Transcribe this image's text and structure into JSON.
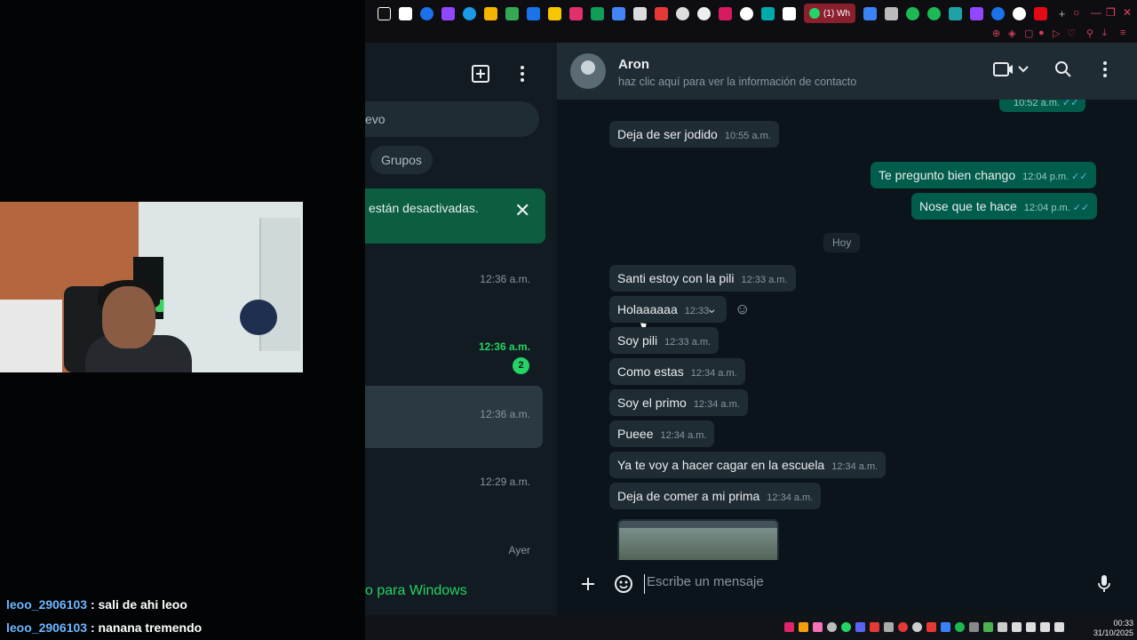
{
  "stream": {
    "chat": [
      {
        "user": "leoo_2906103",
        "message": ": sali de ahi leoo"
      },
      {
        "user": "leoo_2906103",
        "message": ": nanana tremendo"
      }
    ]
  },
  "browser": {
    "active_tab_label": "(1) Wh"
  },
  "sidebar": {
    "search_placeholder_visible": "evo",
    "filter_chip": "Grupos",
    "notice_text": "están desactivadas.",
    "chats": [
      {
        "time": "12:36 a.m.",
        "unread": false,
        "badge": ""
      },
      {
        "time": "12:36 a.m.",
        "unread": true,
        "badge": "2"
      },
      {
        "time": "12:36 a.m.",
        "unread": false,
        "badge": ""
      },
      {
        "time": "12:29 a.m.",
        "unread": false,
        "badge": ""
      },
      {
        "time": "Ayer",
        "unread": false,
        "badge": ""
      }
    ],
    "get_app_text": "o para Windows"
  },
  "conversation": {
    "contact_name": "Aron",
    "contact_subtitle": "haz clic aquí para ver la información de contacto",
    "partial_top_time": "10:52 a.m.",
    "day_separator": "Hoy",
    "messages": [
      {
        "dir": "in",
        "text": "Deja de ser jodido",
        "time": "10:55 a.m."
      },
      {
        "dir": "out",
        "text": "Te pregunto bien chango",
        "time": "12:04 p.m."
      },
      {
        "dir": "out",
        "text": "Nose que te hace",
        "time": "12:04 p.m."
      },
      {
        "dir": "in",
        "text": "Santi estoy con la pili",
        "time": "12:33 a.m."
      },
      {
        "dir": "in",
        "text": "Holaaaaaa",
        "time": "12:33"
      },
      {
        "dir": "in",
        "text": "Soy pili",
        "time": "12:33 a.m."
      },
      {
        "dir": "in",
        "text": "Como estas",
        "time": "12:34 a.m."
      },
      {
        "dir": "in",
        "text": "Soy el primo",
        "time": "12:34 a.m."
      },
      {
        "dir": "in",
        "text": "Pueee",
        "time": "12:34 a.m."
      },
      {
        "dir": "in",
        "text": "Ya te voy a hacer cagar en la escuela",
        "time": "12:34 a.m."
      },
      {
        "dir": "in",
        "text": "Deja de comer a mi prima",
        "time": "12:34 a.m."
      }
    ]
  },
  "composer": {
    "placeholder": "Escribe un mensaje"
  },
  "taskbar": {
    "time": "00:33",
    "date": "31/10/2025"
  },
  "icons": {
    "new_chat": "new-chat-icon",
    "menu": "kebab-menu-icon",
    "video": "video-call-icon",
    "search": "search-icon",
    "plus": "plus-icon",
    "sticker": "sticker-icon",
    "mic": "microphone-icon",
    "close": "close-icon"
  },
  "colors": {
    "wa_green": "#25d366",
    "outgoing_bubble": "#005c4b",
    "incoming_bubble": "#202c33",
    "background": "#0b141a"
  }
}
